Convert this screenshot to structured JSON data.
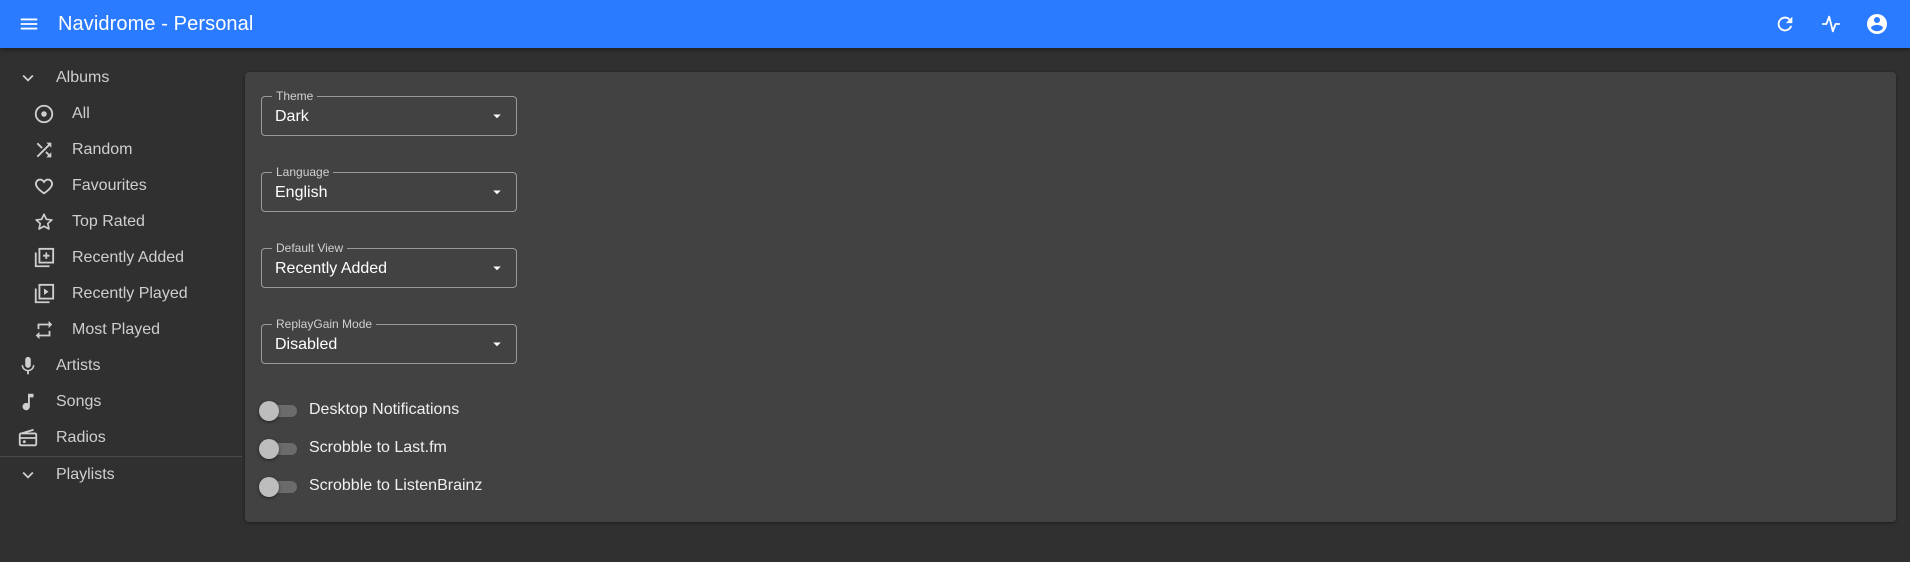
{
  "appbar": {
    "title": "Navidrome - Personal",
    "icons": [
      "menu-icon",
      "refresh-icon",
      "activity-icon",
      "account-circle-icon"
    ]
  },
  "sidebar": {
    "albums_label": "Albums",
    "album_items": [
      {
        "label": "All",
        "icon": "album-icon"
      },
      {
        "label": "Random",
        "icon": "shuffle-icon"
      },
      {
        "label": "Favourites",
        "icon": "heart-icon"
      },
      {
        "label": "Top Rated",
        "icon": "star-icon"
      },
      {
        "label": "Recently Added",
        "icon": "library-add-icon"
      },
      {
        "label": "Recently Played",
        "icon": "library-play-icon"
      },
      {
        "label": "Most Played",
        "icon": "repeat-icon"
      }
    ],
    "artists_label": "Artists",
    "songs_label": "Songs",
    "radios_label": "Radios",
    "playlists_label": "Playlists"
  },
  "settings": {
    "theme": {
      "label": "Theme",
      "value": "Dark"
    },
    "language": {
      "label": "Language",
      "value": "English"
    },
    "default_view": {
      "label": "Default View",
      "value": "Recently Added"
    },
    "replaygain": {
      "label": "ReplayGain Mode",
      "value": "Disabled"
    },
    "toggles": {
      "desktop_notifications": "Desktop Notifications",
      "scrobble_lastfm": "Scrobble to Last.fm",
      "scrobble_listenbrainz": "Scrobble to ListenBrainz"
    }
  },
  "colors": {
    "appbar": "#2a7bff",
    "background": "#303030",
    "card": "#424242"
  }
}
